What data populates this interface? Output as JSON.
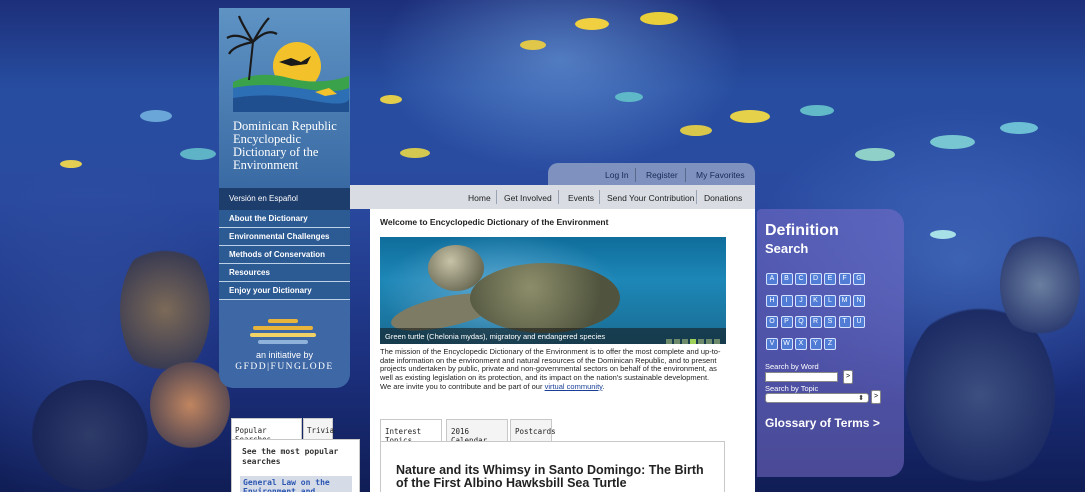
{
  "site": {
    "logo_title": "Dominican Republic Encyclopedic Dictionary of the Environment"
  },
  "left_nav": {
    "spanish": "Versión en Español",
    "items": [
      {
        "label": "About the Dictionary"
      },
      {
        "label": "Environmental Challenges"
      },
      {
        "label": "Methods of Conservation"
      },
      {
        "label": "Resources"
      },
      {
        "label": "Enjoy your Dictionary"
      }
    ],
    "initiative": "an initiative by",
    "org": "GFDD|FUNGLODE"
  },
  "util_nav": {
    "login": "Log In",
    "register": "Register",
    "favorites": "My Favorites"
  },
  "main_nav": {
    "home": "Home",
    "get_involved": "Get Involved",
    "events": "Events",
    "send": "Send Your Contribution",
    "donations": "Donations"
  },
  "content": {
    "welcome": "Welcome to Encyclopedic Dictionary of the Environment",
    "hero_caption": "Green turtle (Chelonia mydas), migratory and endangered species",
    "mission": "The mission of the Encyclopedic Dictionary of the Environment is to offer the most complete and up-to-date information on the environment and natural resources of the Dominican Republic, and to present projects undertaken by public, private and non-governmental sectors on behalf of the environment, as well as existing legislation on its protection, and its impact on the nation's sustainable development.",
    "invite": "We are invite you to contribute and be part of our",
    "invite_link": "virtual community",
    "invite_end": ".",
    "tabs": [
      {
        "label": "Interest Topics"
      },
      {
        "label": "2016 Calendar"
      },
      {
        "label": "Postcards"
      }
    ],
    "article_title": "Nature and its Whimsy in Santo Domingo: The Birth of the First Albino Hawksbill Sea Turtle"
  },
  "popular": {
    "tab_popular": "Popular Searches",
    "tab_trivia": "Trivia",
    "heading": "See the most popular searches",
    "item": "General Law on the Environment and Natural"
  },
  "definition": {
    "title": "Definition",
    "subtitle": "Search",
    "letters": [
      "A",
      "B",
      "C",
      "D",
      "E",
      "F",
      "G",
      "H",
      "I",
      "J",
      "K",
      "L",
      "M",
      "N",
      "O",
      "P",
      "Q",
      "R",
      "S",
      "T",
      "U",
      "V",
      "W",
      "X",
      "Y",
      "Z"
    ],
    "search_word_label": "Search by Word",
    "search_word_placeholder": "",
    "go": ">",
    "search_topic_label": "Search by Topic",
    "topic_arrow": "⬍",
    "glossary": "Glossary of Terms >"
  },
  "colors": {
    "ocean": "#274da0",
    "left_panel": "#3e67a5",
    "nav_item": "#2c5a93",
    "link": "#1a3f99",
    "definition_panel": "#7a6ec8"
  }
}
